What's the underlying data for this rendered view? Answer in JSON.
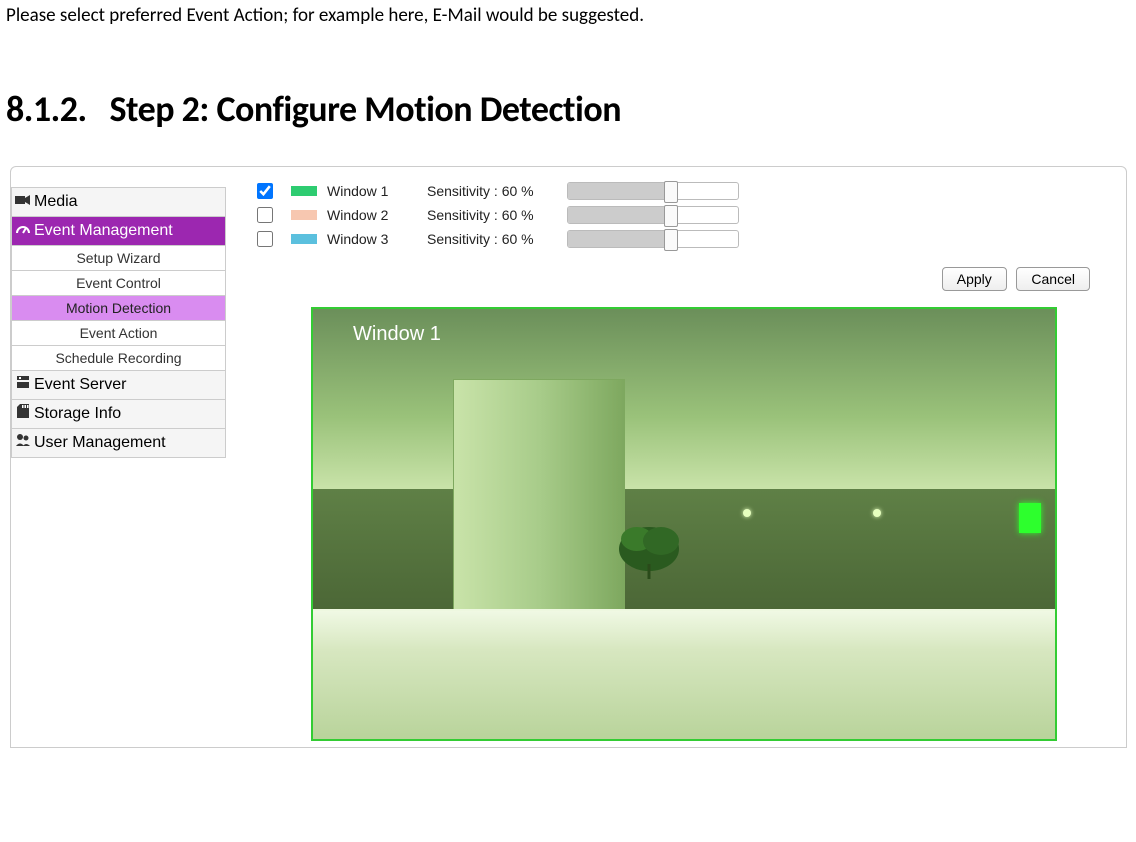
{
  "doc": {
    "instruction": "Please select preferred Event Action; for example here, E-Mail would be suggested.",
    "section_number": "8.1.2.",
    "section_title": "Step 2: Configure Motion Detection"
  },
  "sidebar": {
    "media": "Media",
    "event_management": "Event Management",
    "setup_wizard": "Setup Wizard",
    "event_control": "Event Control",
    "motion_detection": "Motion Detection",
    "event_action": "Event Action",
    "schedule_recording": "Schedule Recording",
    "event_server": "Event Server",
    "storage_info": "Storage Info",
    "user_management": "User Management"
  },
  "windows": [
    {
      "checked": true,
      "name": "Window 1",
      "sens_label": "Sensitivity : 60 %",
      "value": 60
    },
    {
      "checked": false,
      "name": "Window 2",
      "sens_label": "Sensitivity : 60 %",
      "value": 60
    },
    {
      "checked": false,
      "name": "Window 3",
      "sens_label": "Sensitivity : 60 %",
      "value": 60
    }
  ],
  "buttons": {
    "apply": "Apply",
    "cancel": "Cancel"
  },
  "preview": {
    "overlay_label": "Window 1"
  }
}
